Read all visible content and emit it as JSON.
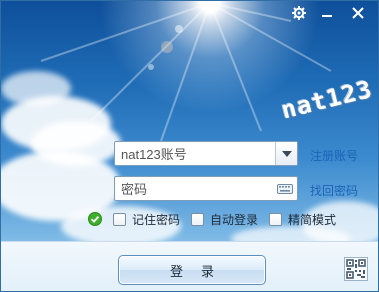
{
  "titlebar": {
    "buttons": [
      {
        "name": "settings-icon"
      },
      {
        "name": "minimize-icon"
      },
      {
        "name": "close-icon"
      }
    ]
  },
  "brand": {
    "text": "nat123"
  },
  "login_form": {
    "account": {
      "value": "nat123账号",
      "dropdown_icon": "chevron-down-icon"
    },
    "password": {
      "value": "密码",
      "keyboard_icon": "keyboard-icon"
    },
    "register_link": "注册账号",
    "recover_link": "找回密码"
  },
  "options": {
    "status_icon": "green-check-icon",
    "remember_password": {
      "label": "记住密码",
      "checked": false
    },
    "auto_login": {
      "label": "自动登录",
      "checked": false
    },
    "simple_mode": {
      "label": "精简模式",
      "checked": false
    }
  },
  "login_button": {
    "label": "登录"
  },
  "qr_icon": "qr-code-icon",
  "colors": {
    "link": "#1a64b8",
    "sky_top": "#0e4f9a",
    "sky_bottom": "#b9dbf3",
    "border": "#2f6fa6"
  }
}
